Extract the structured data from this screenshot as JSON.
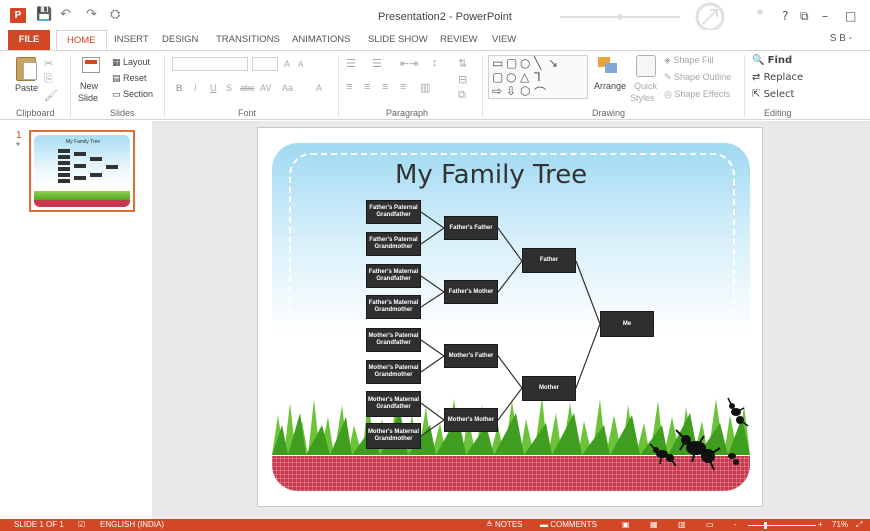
{
  "app": {
    "title": "Presentation2 - PowerPoint",
    "qat_save": "💾",
    "qat_undo": "↶",
    "qat_redo": "↷",
    "qat_customize": "⛭",
    "user": "S B -",
    "window_help": "?",
    "window_restore": "⧉",
    "window_minimize": "–",
    "window_maximize": "□"
  },
  "tabs": [
    "FILE",
    "HOME",
    "INSERT",
    "DESIGN",
    "TRANSITIONS",
    "ANIMATIONS",
    "SLIDE SHOW",
    "REVIEW",
    "VIEW"
  ],
  "ribbon": {
    "clipboard": {
      "label": "Clipboard",
      "paste": "Paste"
    },
    "slides": {
      "label": "Slides",
      "new_slide_1": "New",
      "new_slide_2": "Slide",
      "layout": "Layout",
      "reset": "Reset",
      "section": "Section"
    },
    "font": {
      "label": "Font",
      "bold": "B",
      "italic": "I",
      "underline": "U",
      "strike": "S",
      "abc": "abc",
      "spacing": "AV",
      "case": "Aa",
      "color": "A",
      "grow": "A",
      "shrink": "A"
    },
    "paragraph": {
      "label": "Paragraph"
    },
    "drawing": {
      "label": "Drawing",
      "arrange": "Arrange",
      "quick_styles_1": "Quick",
      "quick_styles_2": "Styles",
      "shape_fill": "Shape Fill",
      "shape_outline": "Shape Outline",
      "shape_effects": "Shape Effects"
    },
    "editing": {
      "label": "Editing",
      "find": "Find",
      "replace": "Replace",
      "select": "Select"
    }
  },
  "thumbnail": {
    "number": "1",
    "star": "*",
    "title": "My Family Tree"
  },
  "slide": {
    "title": "My Family Tree",
    "nodes": {
      "ff": "Father's Paternal Grandfather",
      "fm": "Father's Paternal Grandmother",
      "fmgf": "Father's Maternal Grandfather",
      "fmgm": "Father's Maternal Grandmother",
      "mpgf": "Mother's Paternal Grandfather",
      "mpgm": "Mother's Paternal Grandmother",
      "mmgf": "Mother's Maternal Grandfather",
      "mmgm": "Mother's Maternal Grandmother",
      "father_father": "Father's Father",
      "father_mother": "Father's Mother",
      "mother_father": "Mother's Father",
      "mother_mother": "Mother's Mother",
      "father": "Father",
      "mother": "Mother",
      "me": "Me"
    }
  },
  "status": {
    "slide": "SLIDE 1 OF 1",
    "language": "ENGLISH (INDIA)",
    "notes": "NOTES",
    "comments": "COMMENTS",
    "zoom": "71%",
    "zoom_minus": "-",
    "zoom_plus": "+"
  },
  "colors": {
    "accent": "#d24726",
    "node": "#2f2f2f",
    "tablecloth": "#c8384e"
  }
}
